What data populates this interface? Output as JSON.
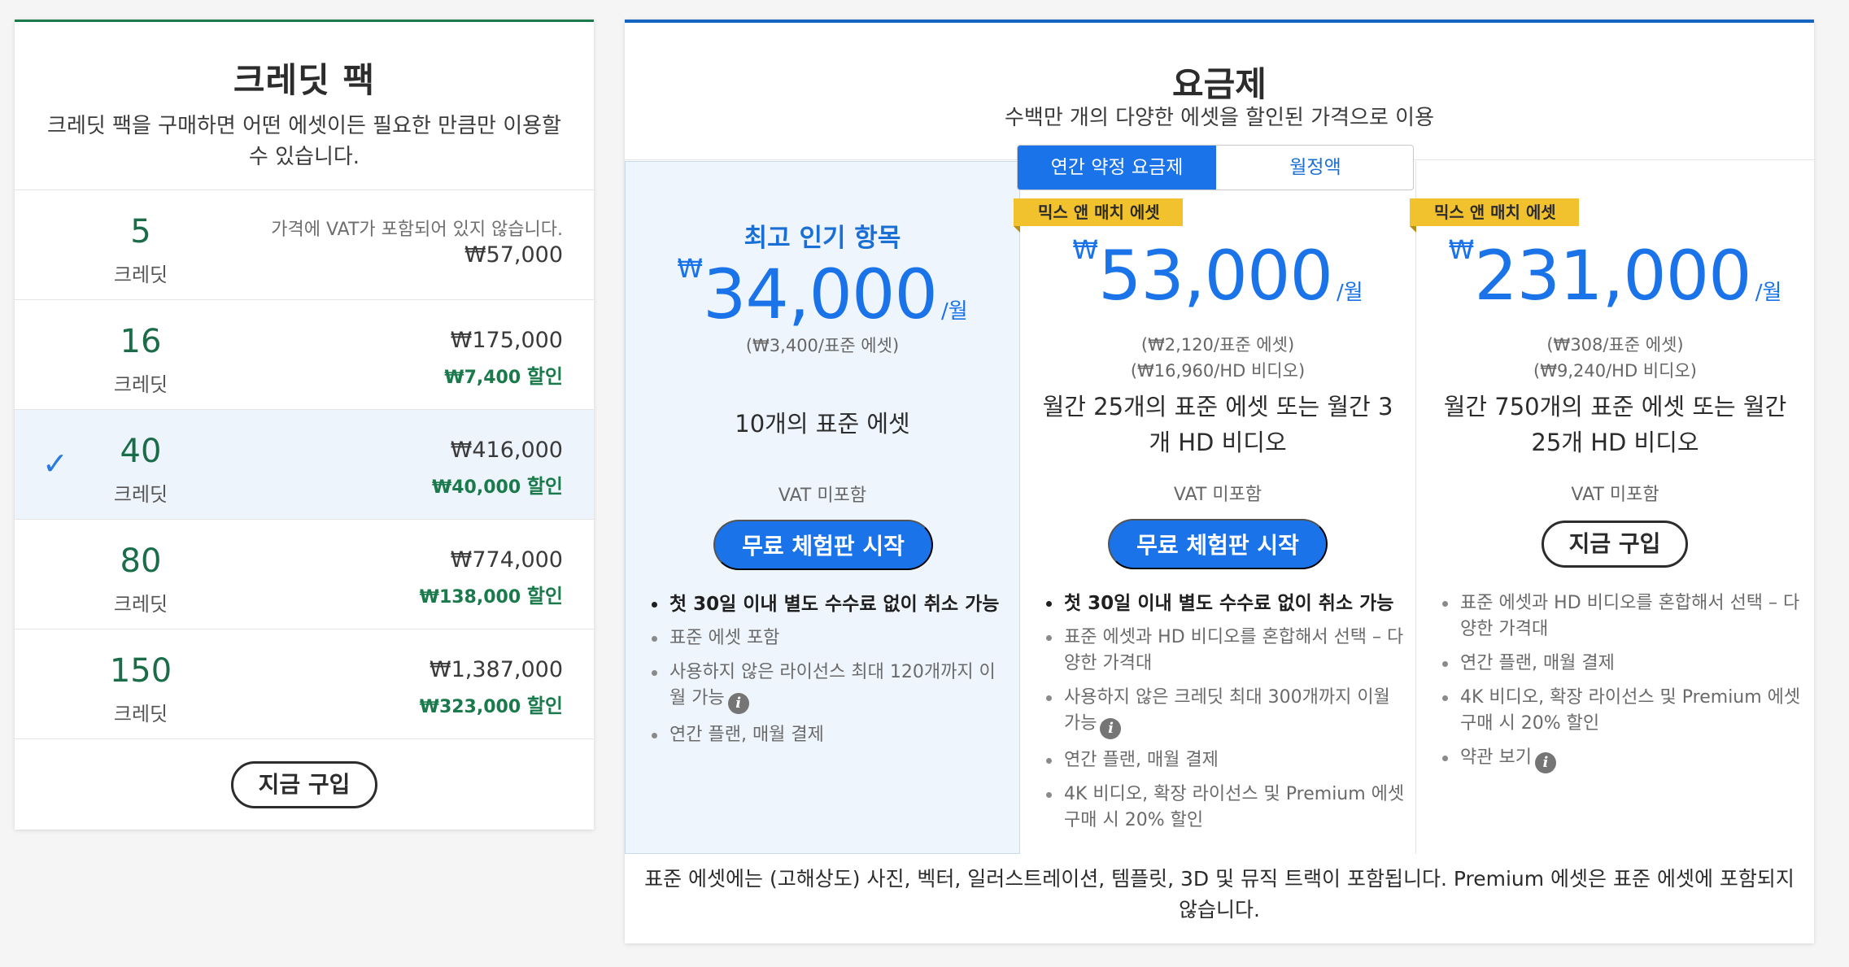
{
  "credit_pack": {
    "title": "크레딧 팩",
    "subtitle": "크레딧 팩을 구매하면 어떤 에셋이든 필요한 만큼만 이용할 수 있습니다.",
    "vat_note": "가격에 VAT가 포함되어 있지 않습니다.",
    "unit_label": "크레딧",
    "discount_label": "할인",
    "rows": [
      {
        "credits": "5",
        "price": "₩57,000",
        "discount": ""
      },
      {
        "credits": "16",
        "price": "₩175,000",
        "discount": "₩7,400"
      },
      {
        "credits": "40",
        "price": "₩416,000",
        "discount": "₩40,000",
        "selected": true
      },
      {
        "credits": "80",
        "price": "₩774,000",
        "discount": "₩138,000"
      },
      {
        "credits": "150",
        "price": "₩1,387,000",
        "discount": "₩323,000"
      }
    ],
    "check_mark": "✓",
    "buy_button": "지금 구입"
  },
  "plans": {
    "title": "요금제",
    "subtitle": "수백만 개의 다양한 에셋을 할인된 가격으로 이용",
    "toggle": {
      "annual": "연간 약정 요금제",
      "monthly": "월정액"
    },
    "selected_toggle": "annual",
    "items": [
      {
        "badge": "",
        "popular": "최고 인기 항목",
        "currency": "₩",
        "amount": "34,000",
        "period": "/월",
        "per_units": [
          "(₩3,400/표준 에셋)"
        ],
        "description": "10개의 표준 에셋",
        "vat": "VAT 미포함",
        "button": "무료 체험판 시작",
        "features": [
          {
            "text": "첫 30일 이내 별도 수수료 없이 취소 가능",
            "bold": true
          },
          {
            "text": "표준 에셋 포함"
          },
          {
            "text": "사용하지 않은 라이선스 최대 120개까지 이월 가능",
            "info": true
          },
          {
            "text": "연간 플랜, 매월 결제"
          }
        ]
      },
      {
        "badge": "믹스 앤 매치 에셋",
        "popular": "",
        "currency": "₩",
        "amount": "53,000",
        "period": "/월",
        "per_units": [
          "(₩2,120/표준 에셋)",
          "(₩16,960/HD 비디오)"
        ],
        "description": "월간 25개의 표준 에셋 또는 월간 3개 HD 비디오",
        "vat": "VAT 미포함",
        "button": "무료 체험판 시작",
        "features": [
          {
            "text": "첫 30일 이내 별도 수수료 없이 취소 가능",
            "bold": true
          },
          {
            "text": "표준 에셋과 HD 비디오를 혼합해서 선택 – 다양한 가격대"
          },
          {
            "text": "사용하지 않은 크레딧 최대 300개까지 이월 가능",
            "info": true
          },
          {
            "text": "연간 플랜, 매월 결제"
          },
          {
            "text": "4K 비디오, 확장 라이선스 및 Premium 에셋 구매 시 20% 할인"
          }
        ]
      },
      {
        "badge": "믹스 앤 매치 에셋",
        "popular": "",
        "currency": "₩",
        "amount": "231,000",
        "period": "/월",
        "per_units": [
          "(₩308/표준 에셋)",
          "(₩9,240/HD 비디오)"
        ],
        "description": "월간 750개의 표준 에셋 또는 월간 25개 HD 비디오",
        "vat": "VAT 미포함",
        "button": "지금 구입",
        "features": [
          {
            "text": "표준 에셋과 HD 비디오를 혼합해서 선택 – 다양한 가격대"
          },
          {
            "text": "연간 플랜, 매월 결제"
          },
          {
            "text": "4K 비디오, 확장 라이선스 및 Premium 에셋 구매 시 20% 할인"
          },
          {
            "text": "약관 보기",
            "info": true
          }
        ]
      }
    ],
    "footer": "표준 에셋에는 (고해상도) 사진, 벡터, 일러스트레이션, 템플릿, 3D 및 뮤직 트랙이 포함됩니다. Premium 에셋은 표준 에셋에 포함되지 않습니다."
  },
  "colors": {
    "accent_blue": "#1a73e8",
    "credit_green": "#1a7a4c",
    "badge_yellow": "#f2c12e"
  }
}
